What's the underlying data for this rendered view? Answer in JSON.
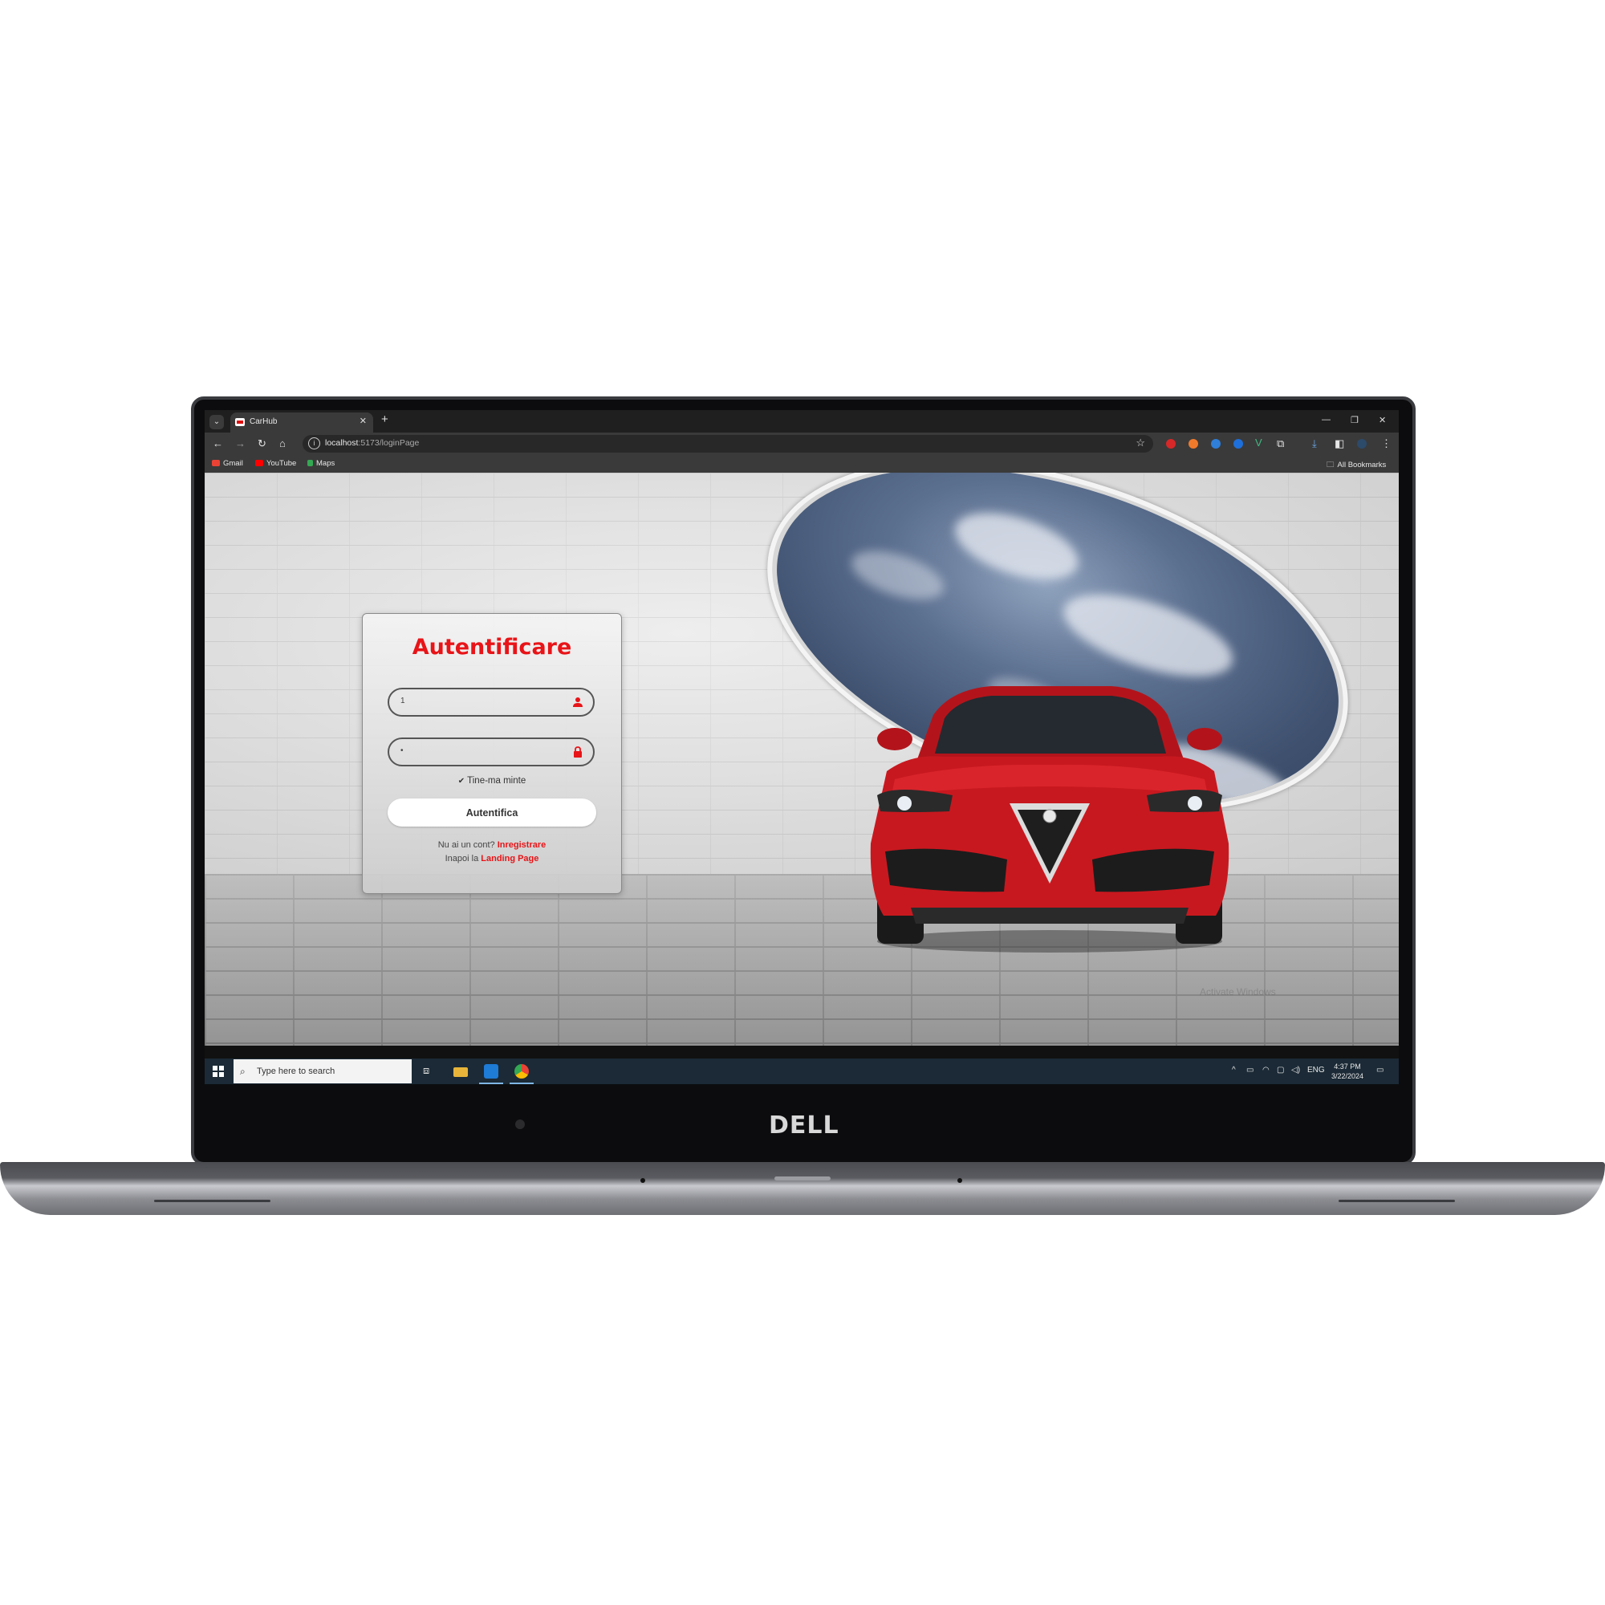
{
  "browser": {
    "tab_title": "CarHub",
    "url_host": "localhost",
    "url_path": ":5173/loginPage",
    "bookmarks": [
      {
        "label": "Gmail",
        "color": "#ea4335"
      },
      {
        "label": "YouTube",
        "color": "#ff0000"
      },
      {
        "label": "Maps",
        "color": "#34a853"
      }
    ],
    "all_bookmarks": "All Bookmarks"
  },
  "login": {
    "title": "Autentificare",
    "username_value": "1",
    "password_value": "•",
    "remember_label": "Tine-ma minte",
    "submit_label": "Autentifica",
    "register_prompt": "Nu ai un cont?",
    "register_link": "Inregistrare",
    "back_prompt": "Inapoi la",
    "back_link": "Landing Page",
    "accent_color": "#e81418"
  },
  "watermark": "Activate Windows",
  "taskbar": {
    "search_placeholder": "Type here to search",
    "language": "ENG",
    "time": "4:37 PM",
    "date": "3/22/2024"
  },
  "device": {
    "brand": "DELL"
  }
}
